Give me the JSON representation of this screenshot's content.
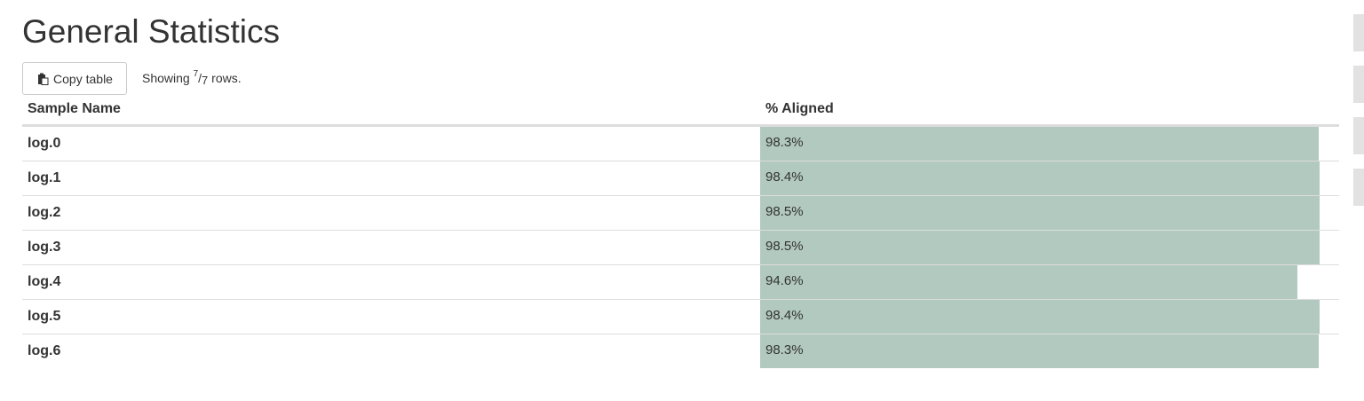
{
  "page": {
    "title": "General Statistics"
  },
  "toolbar": {
    "copy_label": "Copy table",
    "copy_icon": "clipboard-icon",
    "showing_prefix": "Showing",
    "shown_rows": "7",
    "total_rows": "7",
    "showing_suffix": "rows."
  },
  "table": {
    "columns": [
      "Sample Name",
      "% Aligned"
    ],
    "bar_max_percent": 100,
    "bar_color": "#b2c9bf",
    "rows": [
      {
        "name": "log.0",
        "aligned": 98.3,
        "aligned_label": "98.3%"
      },
      {
        "name": "log.1",
        "aligned": 98.4,
        "aligned_label": "98.4%"
      },
      {
        "name": "log.2",
        "aligned": 98.5,
        "aligned_label": "98.5%"
      },
      {
        "name": "log.3",
        "aligned": 98.5,
        "aligned_label": "98.5%"
      },
      {
        "name": "log.4",
        "aligned": 94.6,
        "aligned_label": "94.6%"
      },
      {
        "name": "log.5",
        "aligned": 98.4,
        "aligned_label": "98.4%"
      },
      {
        "name": "log.6",
        "aligned": 98.3,
        "aligned_label": "98.3%"
      }
    ]
  },
  "side_tabs_count": 4
}
